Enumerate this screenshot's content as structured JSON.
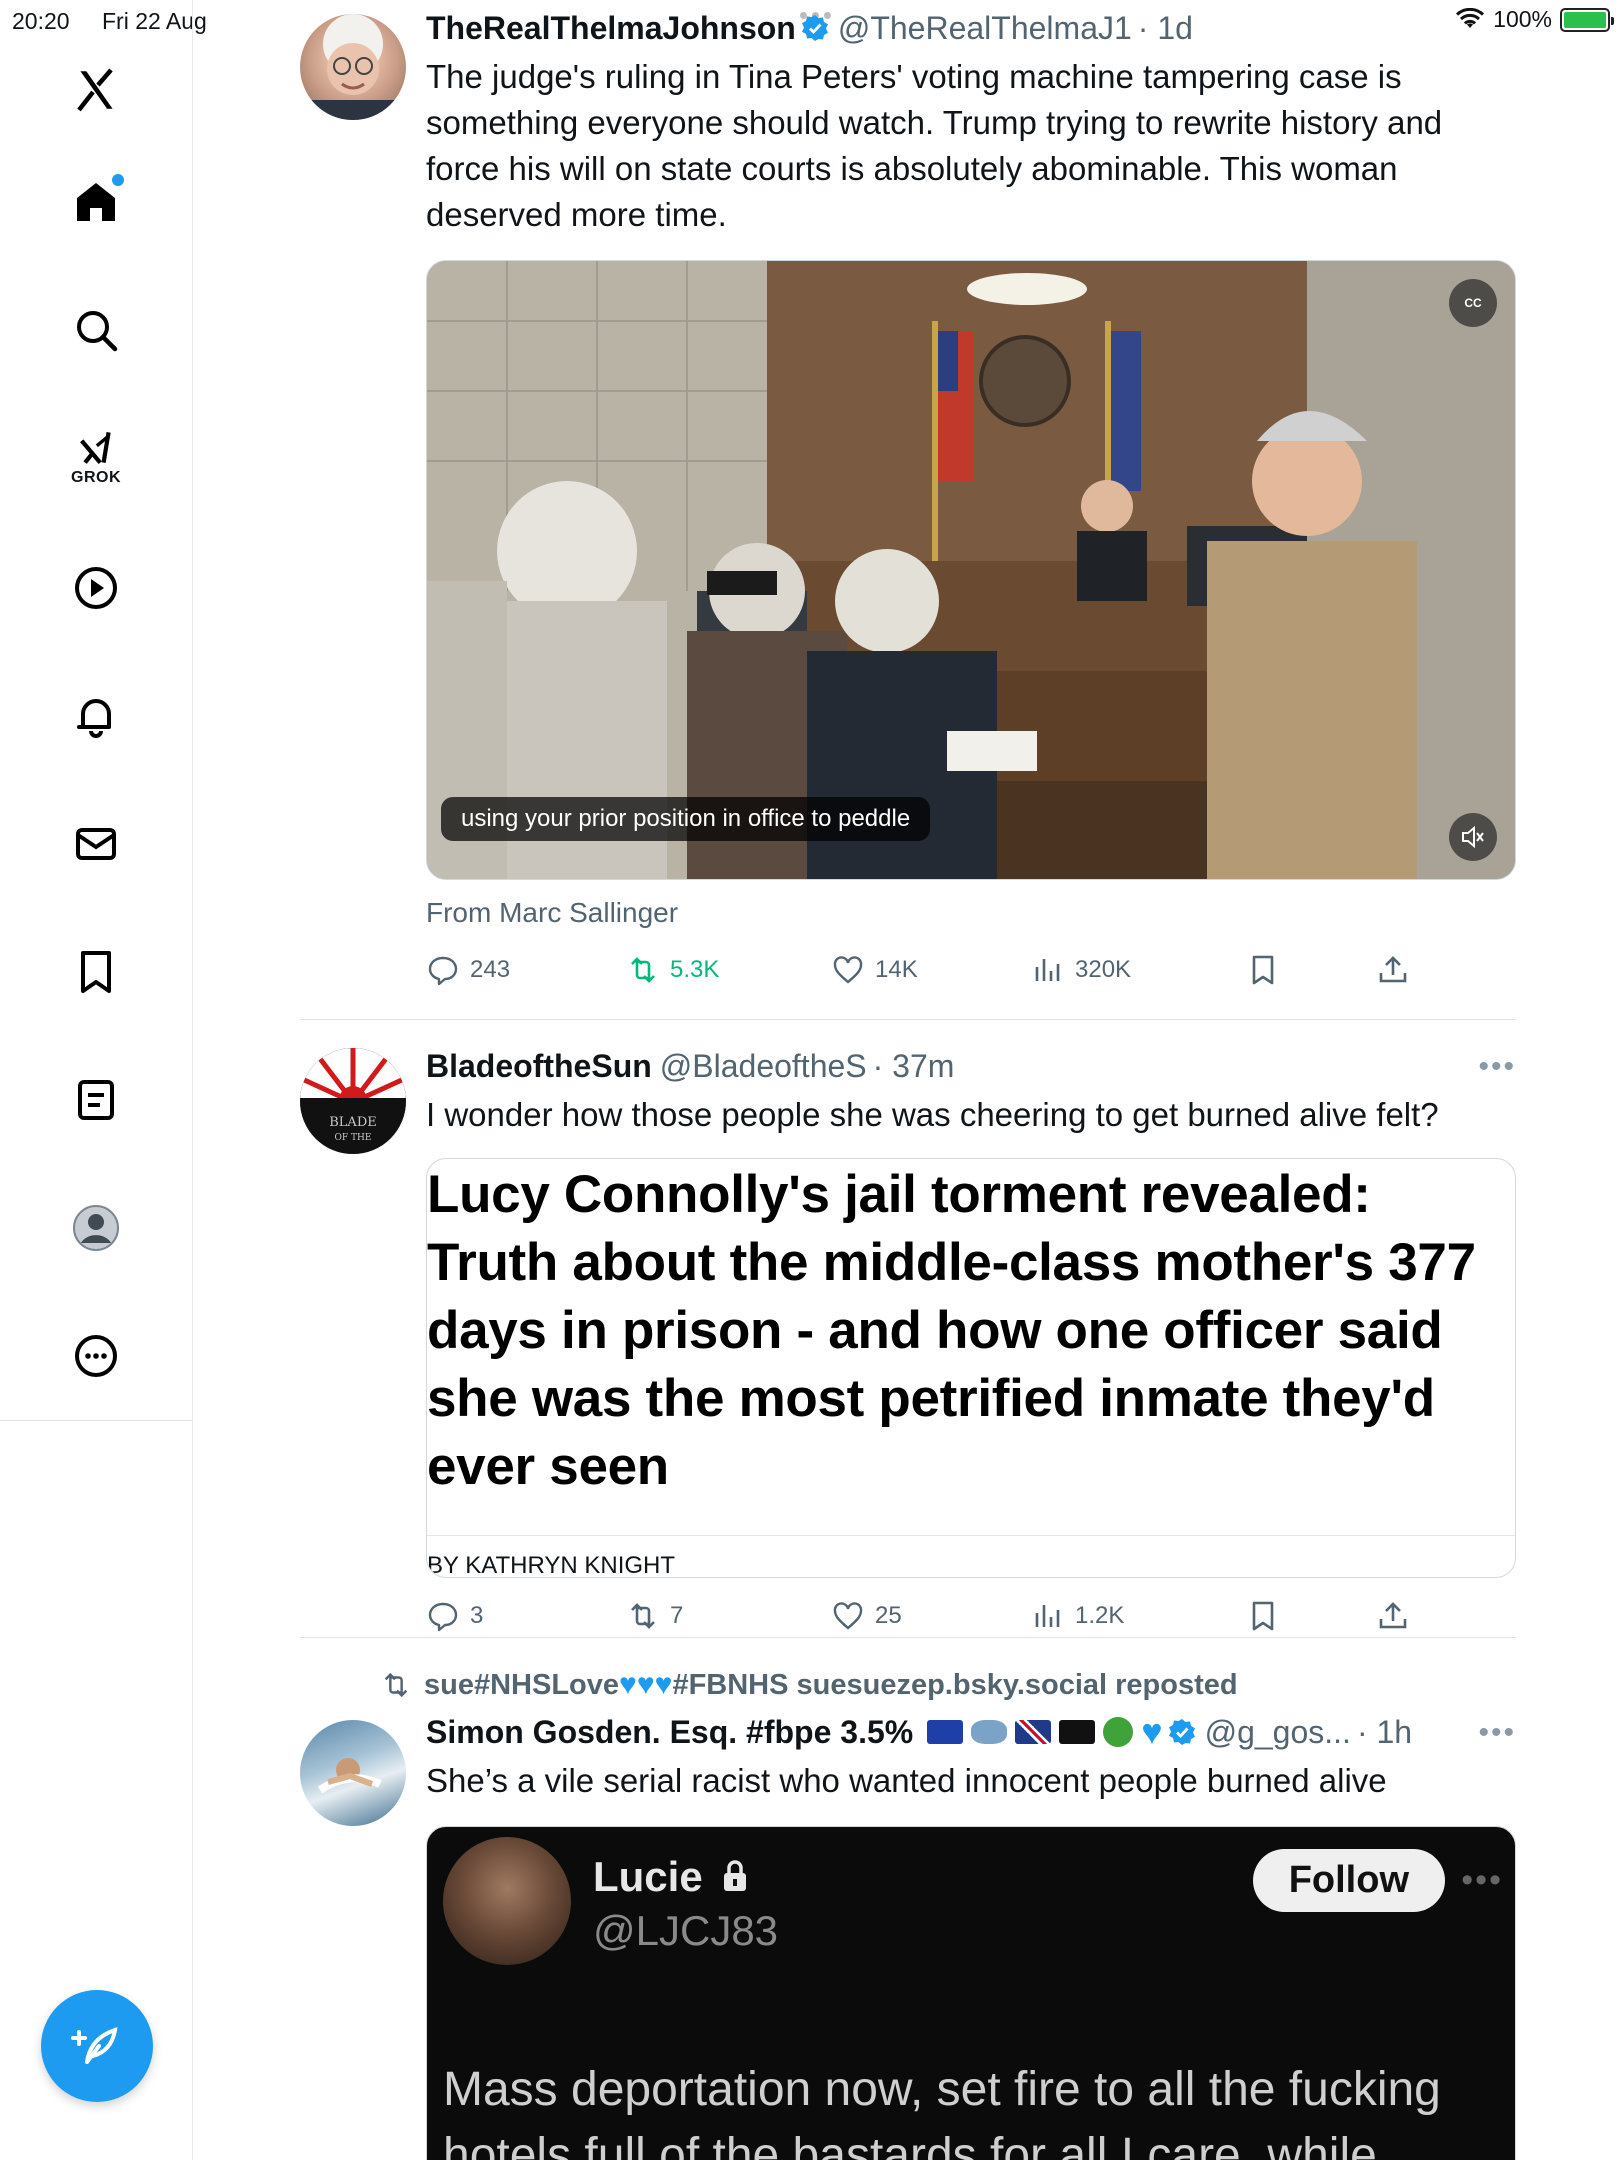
{
  "status_bar": {
    "time": "20:20",
    "date": "Fri 22 Aug",
    "battery": "100%",
    "battery_level": 1.0
  },
  "sidebar": {
    "items": [
      {
        "name": "x-logo"
      },
      {
        "name": "home"
      },
      {
        "name": "search"
      },
      {
        "name": "grok",
        "label": "GROK"
      },
      {
        "name": "video"
      },
      {
        "name": "notifications"
      },
      {
        "name": "messages"
      },
      {
        "name": "bookmarks"
      },
      {
        "name": "lists"
      },
      {
        "name": "profile"
      },
      {
        "name": "more"
      }
    ],
    "compose_icon": "compose-feather-icon"
  },
  "posts": [
    {
      "name": "TheRealThelmaJohnson",
      "handle": "@TheRealThelmaJ1",
      "time": "· 1d",
      "text": "The judge's ruling in Tina Peters' voting machine tampering case is something everyone should watch.  Trump trying to rewrite history and force his will on state courts is absolutely abominable.   This woman deserved more time.",
      "video_caption": "using your prior position in office to peddle",
      "cc_label": "CC",
      "from": "From Marc Sallinger",
      "replies": "243",
      "reposts": "5.3K",
      "likes": "14K",
      "views": "320K"
    },
    {
      "name": "BladeoftheSun",
      "handle": "@BladeoftheS",
      "time": "· 37m",
      "text": "I wonder how those people she was cheering to get burned alive felt?",
      "article_headline": "Lucy Connolly's jail torment revealed: Truth about the middle-class mother's 377 days in prison - and how one officer said she was the most petrified inmate they'd ever seen",
      "article_byline": "By KATHRYN KNIGHT",
      "replies": "3",
      "reposts": "7",
      "likes": "25",
      "views": "1.2K"
    },
    {
      "repost_by_prefix": "sue#NHSLove",
      "repost_by_suffix": "#FBNHS suesuezep.bsky.social reposted",
      "name": "Simon Gosden. Esq. #fbpe 3.5%",
      "handle": "@g_gos...",
      "time": "· 1h",
      "text": "She’s a vile serial racist who wanted innocent people burned alive",
      "embed_name": "Lucie",
      "embed_handle": "@LJCJ83",
      "embed_follow": "Follow",
      "embed_text": "Mass deportation now, set fire to all the fucking hotels full of the bastards for all I care, while"
    }
  ],
  "colors": {
    "accent": "#1d9bf0",
    "repost_green": "#00ba7c",
    "muted": "#536471"
  }
}
